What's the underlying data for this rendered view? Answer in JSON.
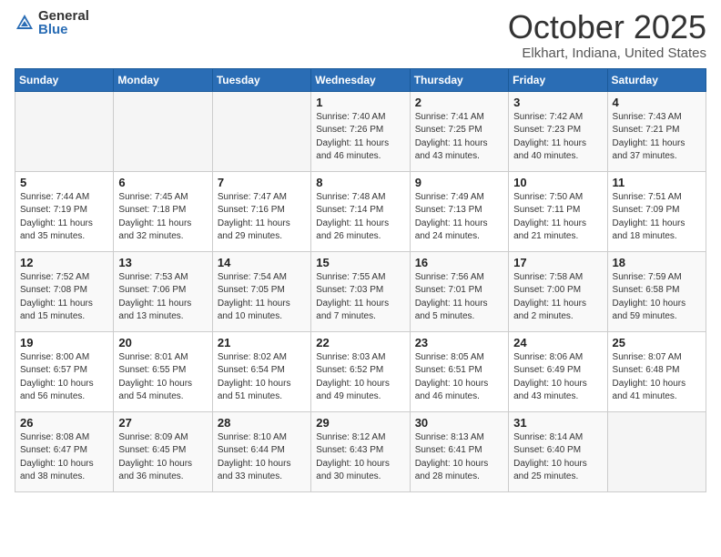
{
  "header": {
    "logo_general": "General",
    "logo_blue": "Blue",
    "month": "October 2025",
    "location": "Elkhart, Indiana, United States"
  },
  "weekdays": [
    "Sunday",
    "Monday",
    "Tuesday",
    "Wednesday",
    "Thursday",
    "Friday",
    "Saturday"
  ],
  "weeks": [
    [
      {
        "day": "",
        "info": ""
      },
      {
        "day": "",
        "info": ""
      },
      {
        "day": "",
        "info": ""
      },
      {
        "day": "1",
        "info": "Sunrise: 7:40 AM\nSunset: 7:26 PM\nDaylight: 11 hours\nand 46 minutes."
      },
      {
        "day": "2",
        "info": "Sunrise: 7:41 AM\nSunset: 7:25 PM\nDaylight: 11 hours\nand 43 minutes."
      },
      {
        "day": "3",
        "info": "Sunrise: 7:42 AM\nSunset: 7:23 PM\nDaylight: 11 hours\nand 40 minutes."
      },
      {
        "day": "4",
        "info": "Sunrise: 7:43 AM\nSunset: 7:21 PM\nDaylight: 11 hours\nand 37 minutes."
      }
    ],
    [
      {
        "day": "5",
        "info": "Sunrise: 7:44 AM\nSunset: 7:19 PM\nDaylight: 11 hours\nand 35 minutes."
      },
      {
        "day": "6",
        "info": "Sunrise: 7:45 AM\nSunset: 7:18 PM\nDaylight: 11 hours\nand 32 minutes."
      },
      {
        "day": "7",
        "info": "Sunrise: 7:47 AM\nSunset: 7:16 PM\nDaylight: 11 hours\nand 29 minutes."
      },
      {
        "day": "8",
        "info": "Sunrise: 7:48 AM\nSunset: 7:14 PM\nDaylight: 11 hours\nand 26 minutes."
      },
      {
        "day": "9",
        "info": "Sunrise: 7:49 AM\nSunset: 7:13 PM\nDaylight: 11 hours\nand 24 minutes."
      },
      {
        "day": "10",
        "info": "Sunrise: 7:50 AM\nSunset: 7:11 PM\nDaylight: 11 hours\nand 21 minutes."
      },
      {
        "day": "11",
        "info": "Sunrise: 7:51 AM\nSunset: 7:09 PM\nDaylight: 11 hours\nand 18 minutes."
      }
    ],
    [
      {
        "day": "12",
        "info": "Sunrise: 7:52 AM\nSunset: 7:08 PM\nDaylight: 11 hours\nand 15 minutes."
      },
      {
        "day": "13",
        "info": "Sunrise: 7:53 AM\nSunset: 7:06 PM\nDaylight: 11 hours\nand 13 minutes."
      },
      {
        "day": "14",
        "info": "Sunrise: 7:54 AM\nSunset: 7:05 PM\nDaylight: 11 hours\nand 10 minutes."
      },
      {
        "day": "15",
        "info": "Sunrise: 7:55 AM\nSunset: 7:03 PM\nDaylight: 11 hours\nand 7 minutes."
      },
      {
        "day": "16",
        "info": "Sunrise: 7:56 AM\nSunset: 7:01 PM\nDaylight: 11 hours\nand 5 minutes."
      },
      {
        "day": "17",
        "info": "Sunrise: 7:58 AM\nSunset: 7:00 PM\nDaylight: 11 hours\nand 2 minutes."
      },
      {
        "day": "18",
        "info": "Sunrise: 7:59 AM\nSunset: 6:58 PM\nDaylight: 10 hours\nand 59 minutes."
      }
    ],
    [
      {
        "day": "19",
        "info": "Sunrise: 8:00 AM\nSunset: 6:57 PM\nDaylight: 10 hours\nand 56 minutes."
      },
      {
        "day": "20",
        "info": "Sunrise: 8:01 AM\nSunset: 6:55 PM\nDaylight: 10 hours\nand 54 minutes."
      },
      {
        "day": "21",
        "info": "Sunrise: 8:02 AM\nSunset: 6:54 PM\nDaylight: 10 hours\nand 51 minutes."
      },
      {
        "day": "22",
        "info": "Sunrise: 8:03 AM\nSunset: 6:52 PM\nDaylight: 10 hours\nand 49 minutes."
      },
      {
        "day": "23",
        "info": "Sunrise: 8:05 AM\nSunset: 6:51 PM\nDaylight: 10 hours\nand 46 minutes."
      },
      {
        "day": "24",
        "info": "Sunrise: 8:06 AM\nSunset: 6:49 PM\nDaylight: 10 hours\nand 43 minutes."
      },
      {
        "day": "25",
        "info": "Sunrise: 8:07 AM\nSunset: 6:48 PM\nDaylight: 10 hours\nand 41 minutes."
      }
    ],
    [
      {
        "day": "26",
        "info": "Sunrise: 8:08 AM\nSunset: 6:47 PM\nDaylight: 10 hours\nand 38 minutes."
      },
      {
        "day": "27",
        "info": "Sunrise: 8:09 AM\nSunset: 6:45 PM\nDaylight: 10 hours\nand 36 minutes."
      },
      {
        "day": "28",
        "info": "Sunrise: 8:10 AM\nSunset: 6:44 PM\nDaylight: 10 hours\nand 33 minutes."
      },
      {
        "day": "29",
        "info": "Sunrise: 8:12 AM\nSunset: 6:43 PM\nDaylight: 10 hours\nand 30 minutes."
      },
      {
        "day": "30",
        "info": "Sunrise: 8:13 AM\nSunset: 6:41 PM\nDaylight: 10 hours\nand 28 minutes."
      },
      {
        "day": "31",
        "info": "Sunrise: 8:14 AM\nSunset: 6:40 PM\nDaylight: 10 hours\nand 25 minutes."
      },
      {
        "day": "",
        "info": ""
      }
    ]
  ]
}
